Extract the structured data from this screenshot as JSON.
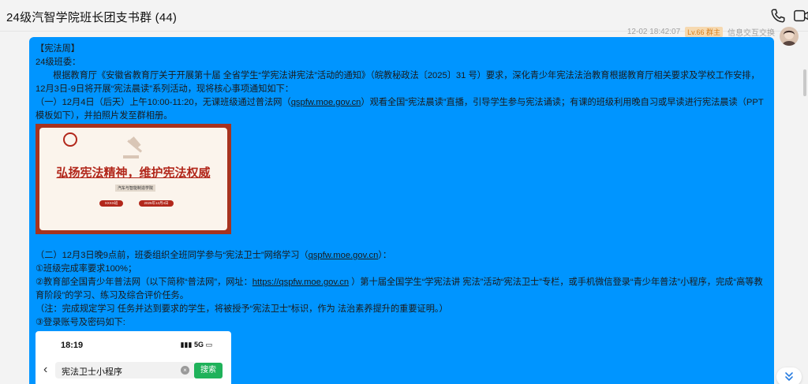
{
  "window": {
    "title": "24级汽智学院班长团支书群 (44)",
    "icons": [
      "phone-icon",
      "video-icon"
    ]
  },
  "message": {
    "timestamp": "12-02 18:42:07",
    "badge": "Lv.66 群主",
    "sender": "信息交互交换",
    "lines": [
      "【宪法周】",
      "24级班委：",
      "根据教育厅《安徽省教育厅关于开展第十届 全省学生“学宪法讲宪法”活动的通知》（皖教秘政法〔2025〕31 号）要求，深化青少年宪法法治教育根据教育厅相关要求及学校工作安排，12月3日-9日将开展“宪法晨读”系列活动，现将核心事项通知如下：",
      "（一）12月4日（后天）上午10:00-11:20，无课班级通过普法网（qspfw.moe.gov.cn）观看全国“宪法晨读”直播，引导学生参与宪法诵读；有课的班级利用晚自习或早读进行宪法晨读（PPT模板如下），并拍照片发至群相册。",
      "（二）12月3日晚9点前，班委组织全班同学参与“宪法卫士”网络学习（qspfw.moe.gov.cn）：",
      "①班级完成率要求100%；",
      "②教育部全国青少年普法网（以下简称“普法网”，网址：https://qspfw.moe.gov.cn ）第十届全国学生“学宪法讲 宪法”活动“宪法卫士”专栏，或手机微信登录“青少年普法”小程序，完成“高等教育阶段”的学习、练习及综合评价任务。",
      "（注：完成规定学习 任务并达到要求的学生，将被授予“宪法卫士”标识，作为 法治素养提升的重要证明。）",
      "③登录账号及密码如下:"
    ]
  },
  "poster": {
    "title": "弘扬宪法精神，维护宪法权威",
    "subtitle": "汽车与智能制造学院",
    "pill_left": "XXXX班",
    "pill_right": "2025年12月4日"
  },
  "phone": {
    "time": "18:19",
    "status": "5G",
    "search_value": "宪法卫士小程序",
    "search_button": "搜索"
  },
  "colors": {
    "bubble": "#0095ff",
    "poster_red": "#b2271b",
    "search_green": "#1fb25a"
  }
}
